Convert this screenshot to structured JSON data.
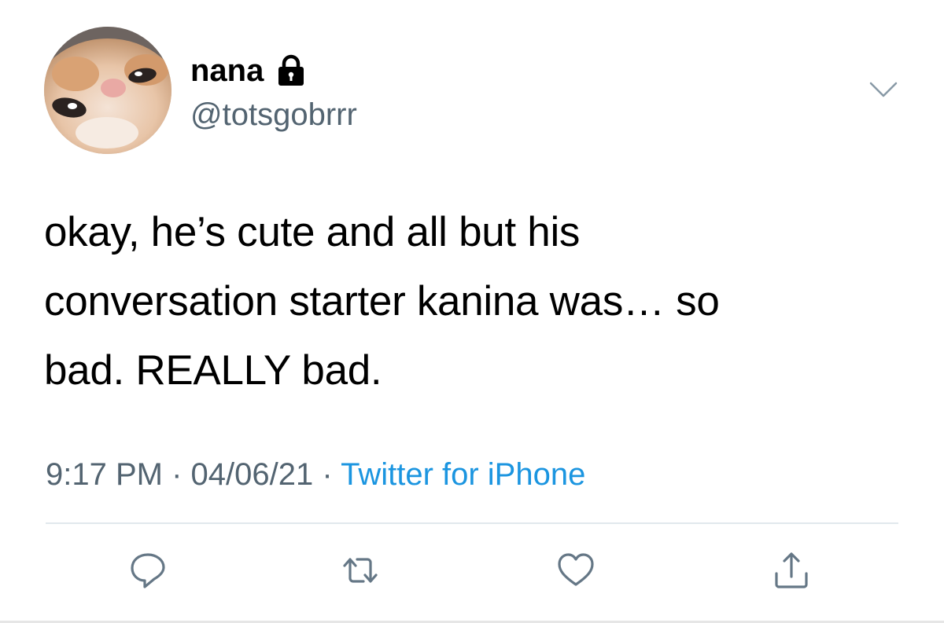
{
  "user": {
    "display_name": "nana",
    "handle": "@totsgobrrr",
    "protected_icon": "lock-icon",
    "avatar": "cat-avatar"
  },
  "tweet": {
    "lines": [
      "okay, he’s cute and all but his",
      "conversation starter kanina was… so",
      "bad. REALLY bad."
    ],
    "time": "9:17 PM",
    "date": "04/06/21",
    "separator": "·",
    "source": "Twitter for iPhone"
  },
  "actions": [
    {
      "icon": "reply-icon"
    },
    {
      "icon": "retweet-icon"
    },
    {
      "icon": "like-icon"
    },
    {
      "icon": "share-icon"
    }
  ],
  "menu": {
    "icon": "chevron-down-icon"
  },
  "colors": {
    "text": "#000000",
    "secondary": "#536471",
    "link": "#1b95e0",
    "divider": "#e1e8ed",
    "icon": "#657786"
  }
}
